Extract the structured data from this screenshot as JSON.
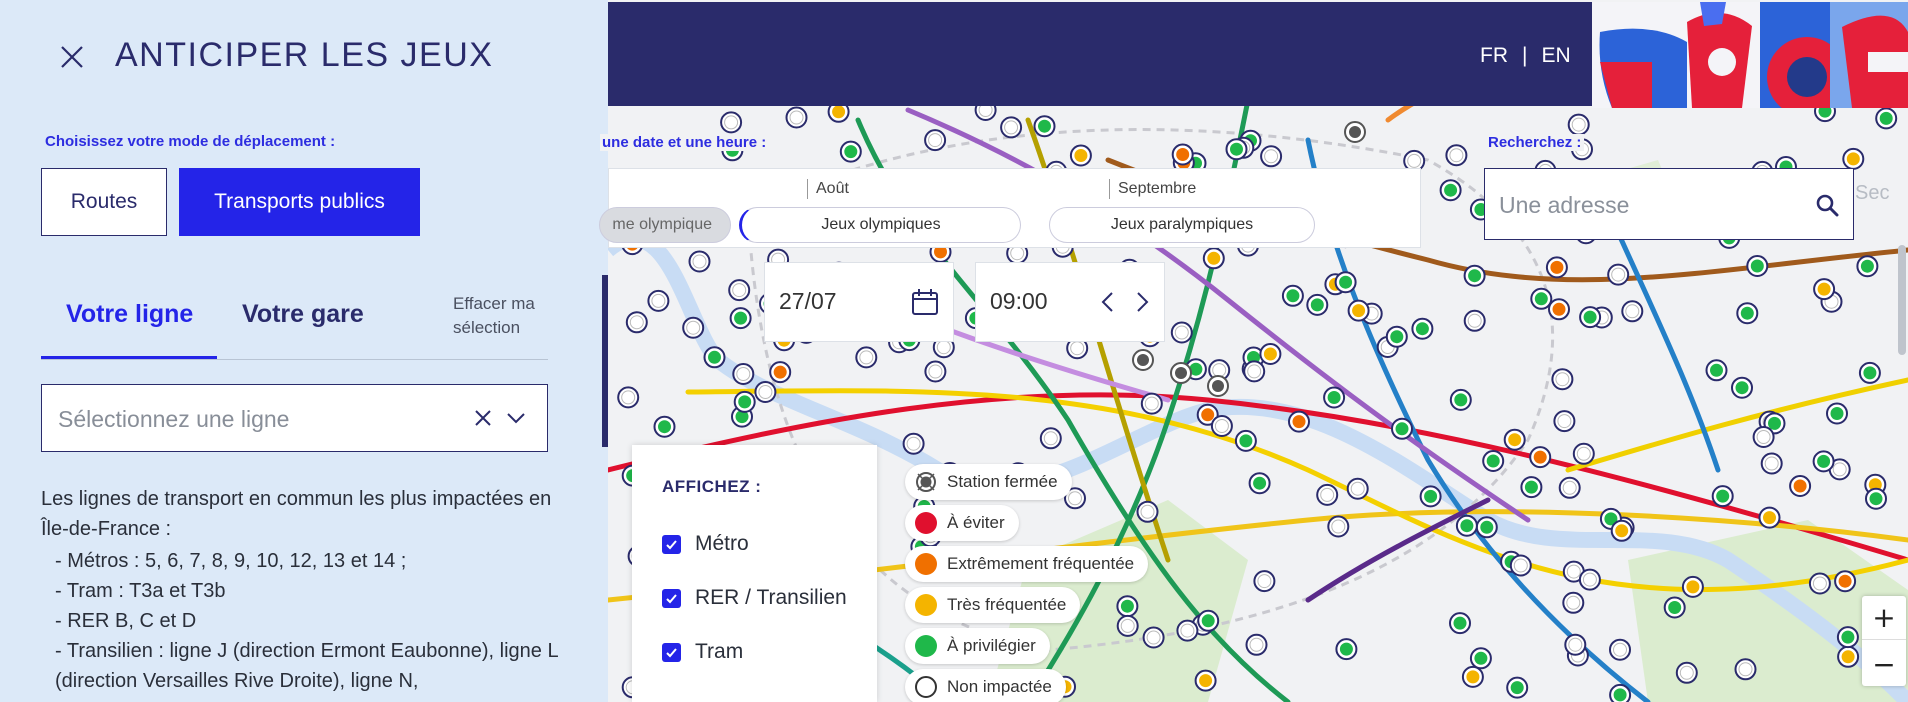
{
  "header": {
    "lang_fr": "FR",
    "lang_sep": "|",
    "lang_en": "EN"
  },
  "panel": {
    "title": "ANTICIPER LES JEUX",
    "mode_label": "Choisissez votre mode de déplacement :",
    "mode_routes": "Routes",
    "mode_transports": "Transports publics",
    "tab_ligne": "Votre ligne",
    "tab_gare": "Votre gare",
    "clear_selection": "Effacer ma sélection",
    "line_select_placeholder": "Sélectionnez une ligne",
    "info_intro": "Les lignes de transport en commun les plus impactées en Île-de-France :",
    "info_items": [
      "- Métros : 5, 6, 7, 8, 9, 10, 12, 13 et 14 ;",
      "- Tram : T3a et T3b",
      "- RER B, C et D",
      "- Transilien : ligne J (direction Ermont Eaubonne), ligne L (direction Versailles Rive Droite), ligne N,"
    ]
  },
  "date_picker": {
    "label": "une date et une heure :",
    "month_1": "Août",
    "month_2": "Septembre",
    "period_0": "me olympique",
    "period_1": "Jeux olympiques",
    "period_2": "Jeux paralympiques",
    "date_value": "27/07",
    "time_value": "09:00"
  },
  "search": {
    "label": "Recherchez :",
    "placeholder": "Une adresse",
    "cut_text": "Sec"
  },
  "layers": {
    "title": "AFFICHEZ :",
    "metro": "Métro",
    "rer": "RER / Transilien",
    "tram": "Tram"
  },
  "legend": {
    "closed": "Station fermée",
    "avoid": "À éviter",
    "extreme": "Extrêmement fréquentée",
    "very": "Très fréquentée",
    "favor": "À privilégier",
    "none": "Non impactée"
  },
  "colors": {
    "navy": "#2a2b6b",
    "accent_blue": "#2424e8",
    "avoid": "#e0102e",
    "extreme": "#f07000",
    "very": "#f4b400",
    "favor": "#1fb84a",
    "closed": "#555555"
  },
  "zoom": {
    "in": "+",
    "out": "−"
  }
}
